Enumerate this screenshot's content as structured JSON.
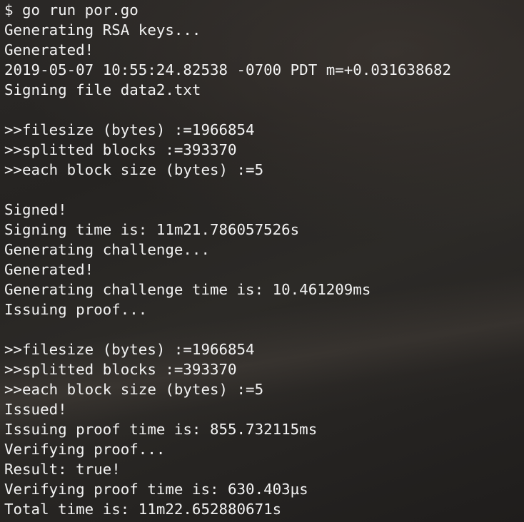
{
  "terminal": {
    "lines": [
      "$ go run por.go",
      "Generating RSA keys...",
      "Generated!",
      "2019-05-07 10:55:24.82538 -0700 PDT m=+0.031638682",
      "Signing file data2.txt",
      "",
      ">>filesize (bytes) :=1966854",
      ">>splitted blocks :=393370",
      ">>each block size (bytes) :=5",
      "",
      "Signed!",
      "Signing time is: 11m21.786057526s",
      "Generating challenge...",
      "Generated!",
      "Generating challenge time is: 10.461209ms",
      "Issuing proof...",
      "",
      ">>filesize (bytes) :=1966854",
      ">>splitted blocks :=393370",
      ">>each block size (bytes) :=5",
      "Issued!",
      "Issuing proof time is: 855.732115ms",
      "Verifying proof...",
      "Result: true!",
      "Verifying proof time is: 630.403µs",
      "Total time is: 11m22.652880671s"
    ]
  },
  "colors": {
    "text": "#f2f2f2",
    "background": "#262422"
  }
}
